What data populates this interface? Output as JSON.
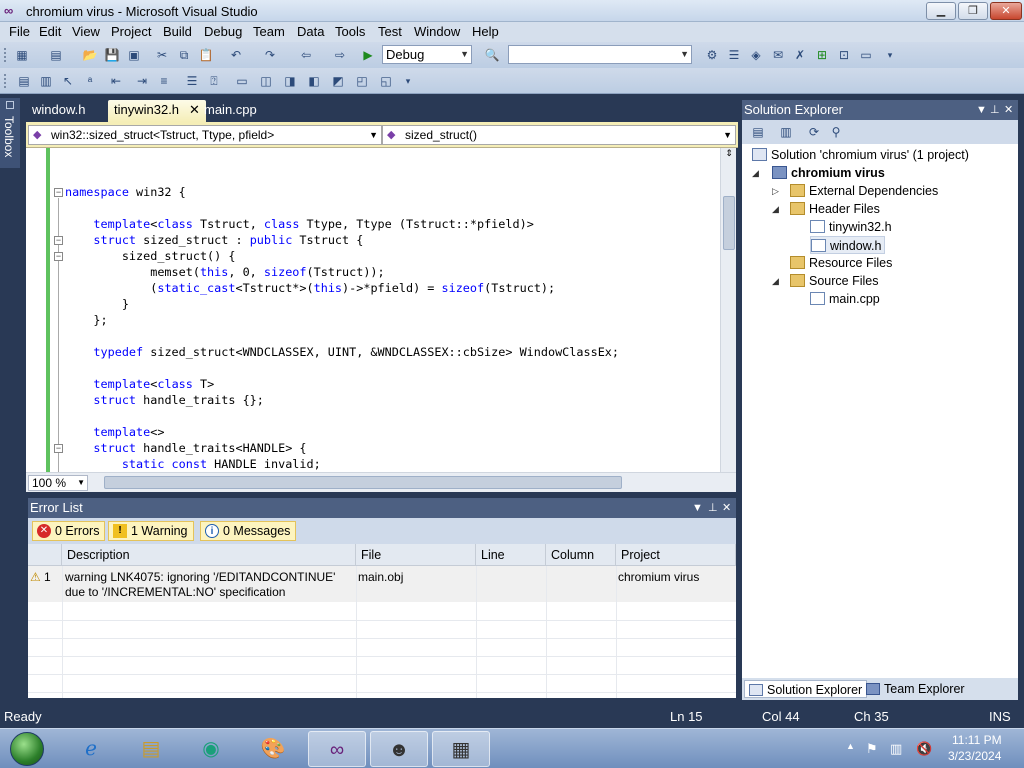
{
  "window": {
    "title": "chromium virus - Microsoft Visual Studio",
    "min": "▁",
    "max": "❐",
    "close": "✕"
  },
  "menu": [
    "File",
    "Edit",
    "View",
    "Project",
    "Build",
    "Debug",
    "Team",
    "Data",
    "Tools",
    "Test",
    "Window",
    "Help"
  ],
  "toolbar": {
    "config": "Debug",
    "platform": ""
  },
  "toolbox": {
    "label": "Toolbox"
  },
  "tabs": [
    {
      "label": "window.h"
    },
    {
      "label": "tinywin32.h",
      "close": "✕"
    },
    {
      "label": "main.cpp"
    }
  ],
  "nav": {
    "scope": "win32::sized_struct<Tstruct, Ttype, pfield>",
    "member": "sized_struct()"
  },
  "code": {
    "lines": [
      "namespace win32 {",
      "",
      "    template<class Tstruct, class Ttype, Ttype (Tstruct::*pfield)>",
      "    struct sized_struct : public Tstruct {",
      "        sized_struct() {",
      "            memset(this, 0, sizeof(Tstruct));",
      "            (static_cast<Tstruct*>(this)->*pfield) = sizeof(Tstruct);",
      "        }",
      "    };",
      "",
      "    typedef sized_struct<WNDCLASSEX, UINT, &WNDCLASSEX::cbSize> WindowClassEx;",
      "",
      "    template<class T>",
      "    struct handle_traits {};",
      "",
      "    template<>",
      "    struct handle_traits<HANDLE> {",
      "        static const HANDLE invalid;"
    ]
  },
  "editor": {
    "zoom": "100 %"
  },
  "solution_explorer": {
    "title": "Solution Explorer",
    "solution": "Solution 'chromium virus' (1 project)",
    "project": "chromium virus",
    "external": "External Dependencies",
    "header_files": "Header Files",
    "header1": "tinywin32.h",
    "header2": "window.h",
    "resource_files": "Resource Files",
    "source_files": "Source Files",
    "source1": "main.cpp",
    "tab1": "Solution Explorer",
    "tab2": "Team Explorer"
  },
  "error_list": {
    "title": "Error List",
    "errors": "0 Errors",
    "warnings": "1 Warning",
    "messages": "0 Messages",
    "columns": {
      "description": "Description",
      "file": "File",
      "line": "Line",
      "column": "Column",
      "project": "Project"
    },
    "rows": [
      {
        "index": "1",
        "description1": "warning LNK4075: ignoring '/EDITANDCONTINUE'",
        "description2": "due to '/INCREMENTAL:NO' specification",
        "file": "main.obj",
        "project": "chromium virus"
      }
    ]
  },
  "status": {
    "ready": "Ready",
    "ln": "Ln 15",
    "col": "Col 44",
    "ch": "Ch 35",
    "ins": "INS"
  },
  "taskbar": {
    "time": "11:11 PM",
    "date": "3/23/2024"
  },
  "colors": {
    "accent": "#293955",
    "tab_active": "#f5eeb7",
    "keyword": "#0000ff"
  }
}
